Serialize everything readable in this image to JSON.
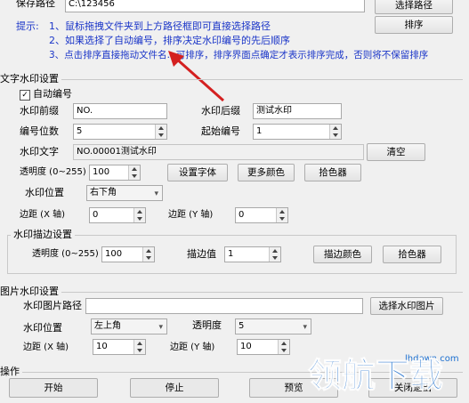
{
  "top": {
    "save_path_label": "保存路径",
    "save_path_value": "C:\\123456",
    "select_path_button": "选择路径",
    "sort_button": "排序"
  },
  "tips": {
    "label": "提示:",
    "line1": "1、鼠标拖拽文件夹到上方路径框即可直接选择路径",
    "line2": "2、如果选择了自动编号，排序决定水印编号的先后顺序",
    "line3": "3、点击排序直接拖动文件名...可排序，排序界面点确定才表示排序完成，否则将不保留排序"
  },
  "text_watermark": {
    "section_title": "文字水印设置",
    "auto_number_label": "自动编号",
    "auto_number_checked": true,
    "prefix_label": "水印前缀",
    "prefix_value": "NO.",
    "suffix_label": "水印后缀",
    "suffix_value": "测试水印",
    "digits_label": "编号位数",
    "digits_value": "5",
    "start_label": "起始编号",
    "start_value": "1",
    "text_label": "水印文字",
    "text_value": "NO.00001测试水印",
    "clear_button": "清空",
    "opacity_label": "透明度 (0~255)",
    "opacity_value": "100",
    "font_button": "设置字体",
    "more_colors_button": "更多颜色",
    "picker_button": "拾色器",
    "position_label": "水印位置",
    "position_value": "右下角",
    "margin_x_label": "边距 (X 轴)",
    "margin_x_value": "0",
    "margin_y_label": "边距 (Y 轴)",
    "margin_y_value": "0"
  },
  "stroke": {
    "section_title": "水印描边设置",
    "opacity_label": "透明度 (0~255)",
    "opacity_value": "100",
    "stroke_value_label": "描边值",
    "stroke_value": "1",
    "stroke_color_button": "描边颜色",
    "picker_button": "拾色器"
  },
  "image_watermark": {
    "section_title": "图片水印设置",
    "path_label": "水印图片路径",
    "path_value": "",
    "select_button": "选择水印图片",
    "position_label": "水印位置",
    "position_value": "左上角",
    "opacity_label": "透明度",
    "opacity_value": "5",
    "margin_x_label": "边距 (X 轴)",
    "margin_x_value": "10",
    "margin_y_label": "边距 (Y 轴)",
    "margin_y_value": "10"
  },
  "operations": {
    "section_title": "操作",
    "start_button": "开始",
    "stop_button": "停止",
    "preview_button": "预览",
    "close_button": "关闭退出"
  },
  "watermark_overlay": {
    "logo_text": "领航下载",
    "url_text": "lhdown.com"
  },
  "colors": {
    "tip_blue": "#1a35c8",
    "arrow_red": "#d42020"
  }
}
